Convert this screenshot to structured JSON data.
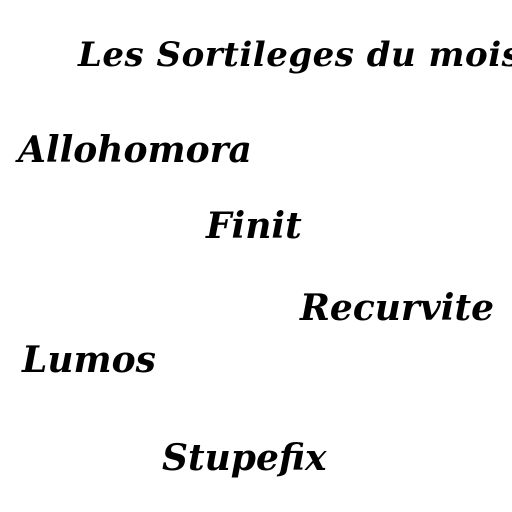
{
  "title": "Les Sortileges du mois",
  "spells": [
    "Allohomora",
    "Finit",
    "Recurvite",
    "Lumos",
    "Stupefix"
  ]
}
